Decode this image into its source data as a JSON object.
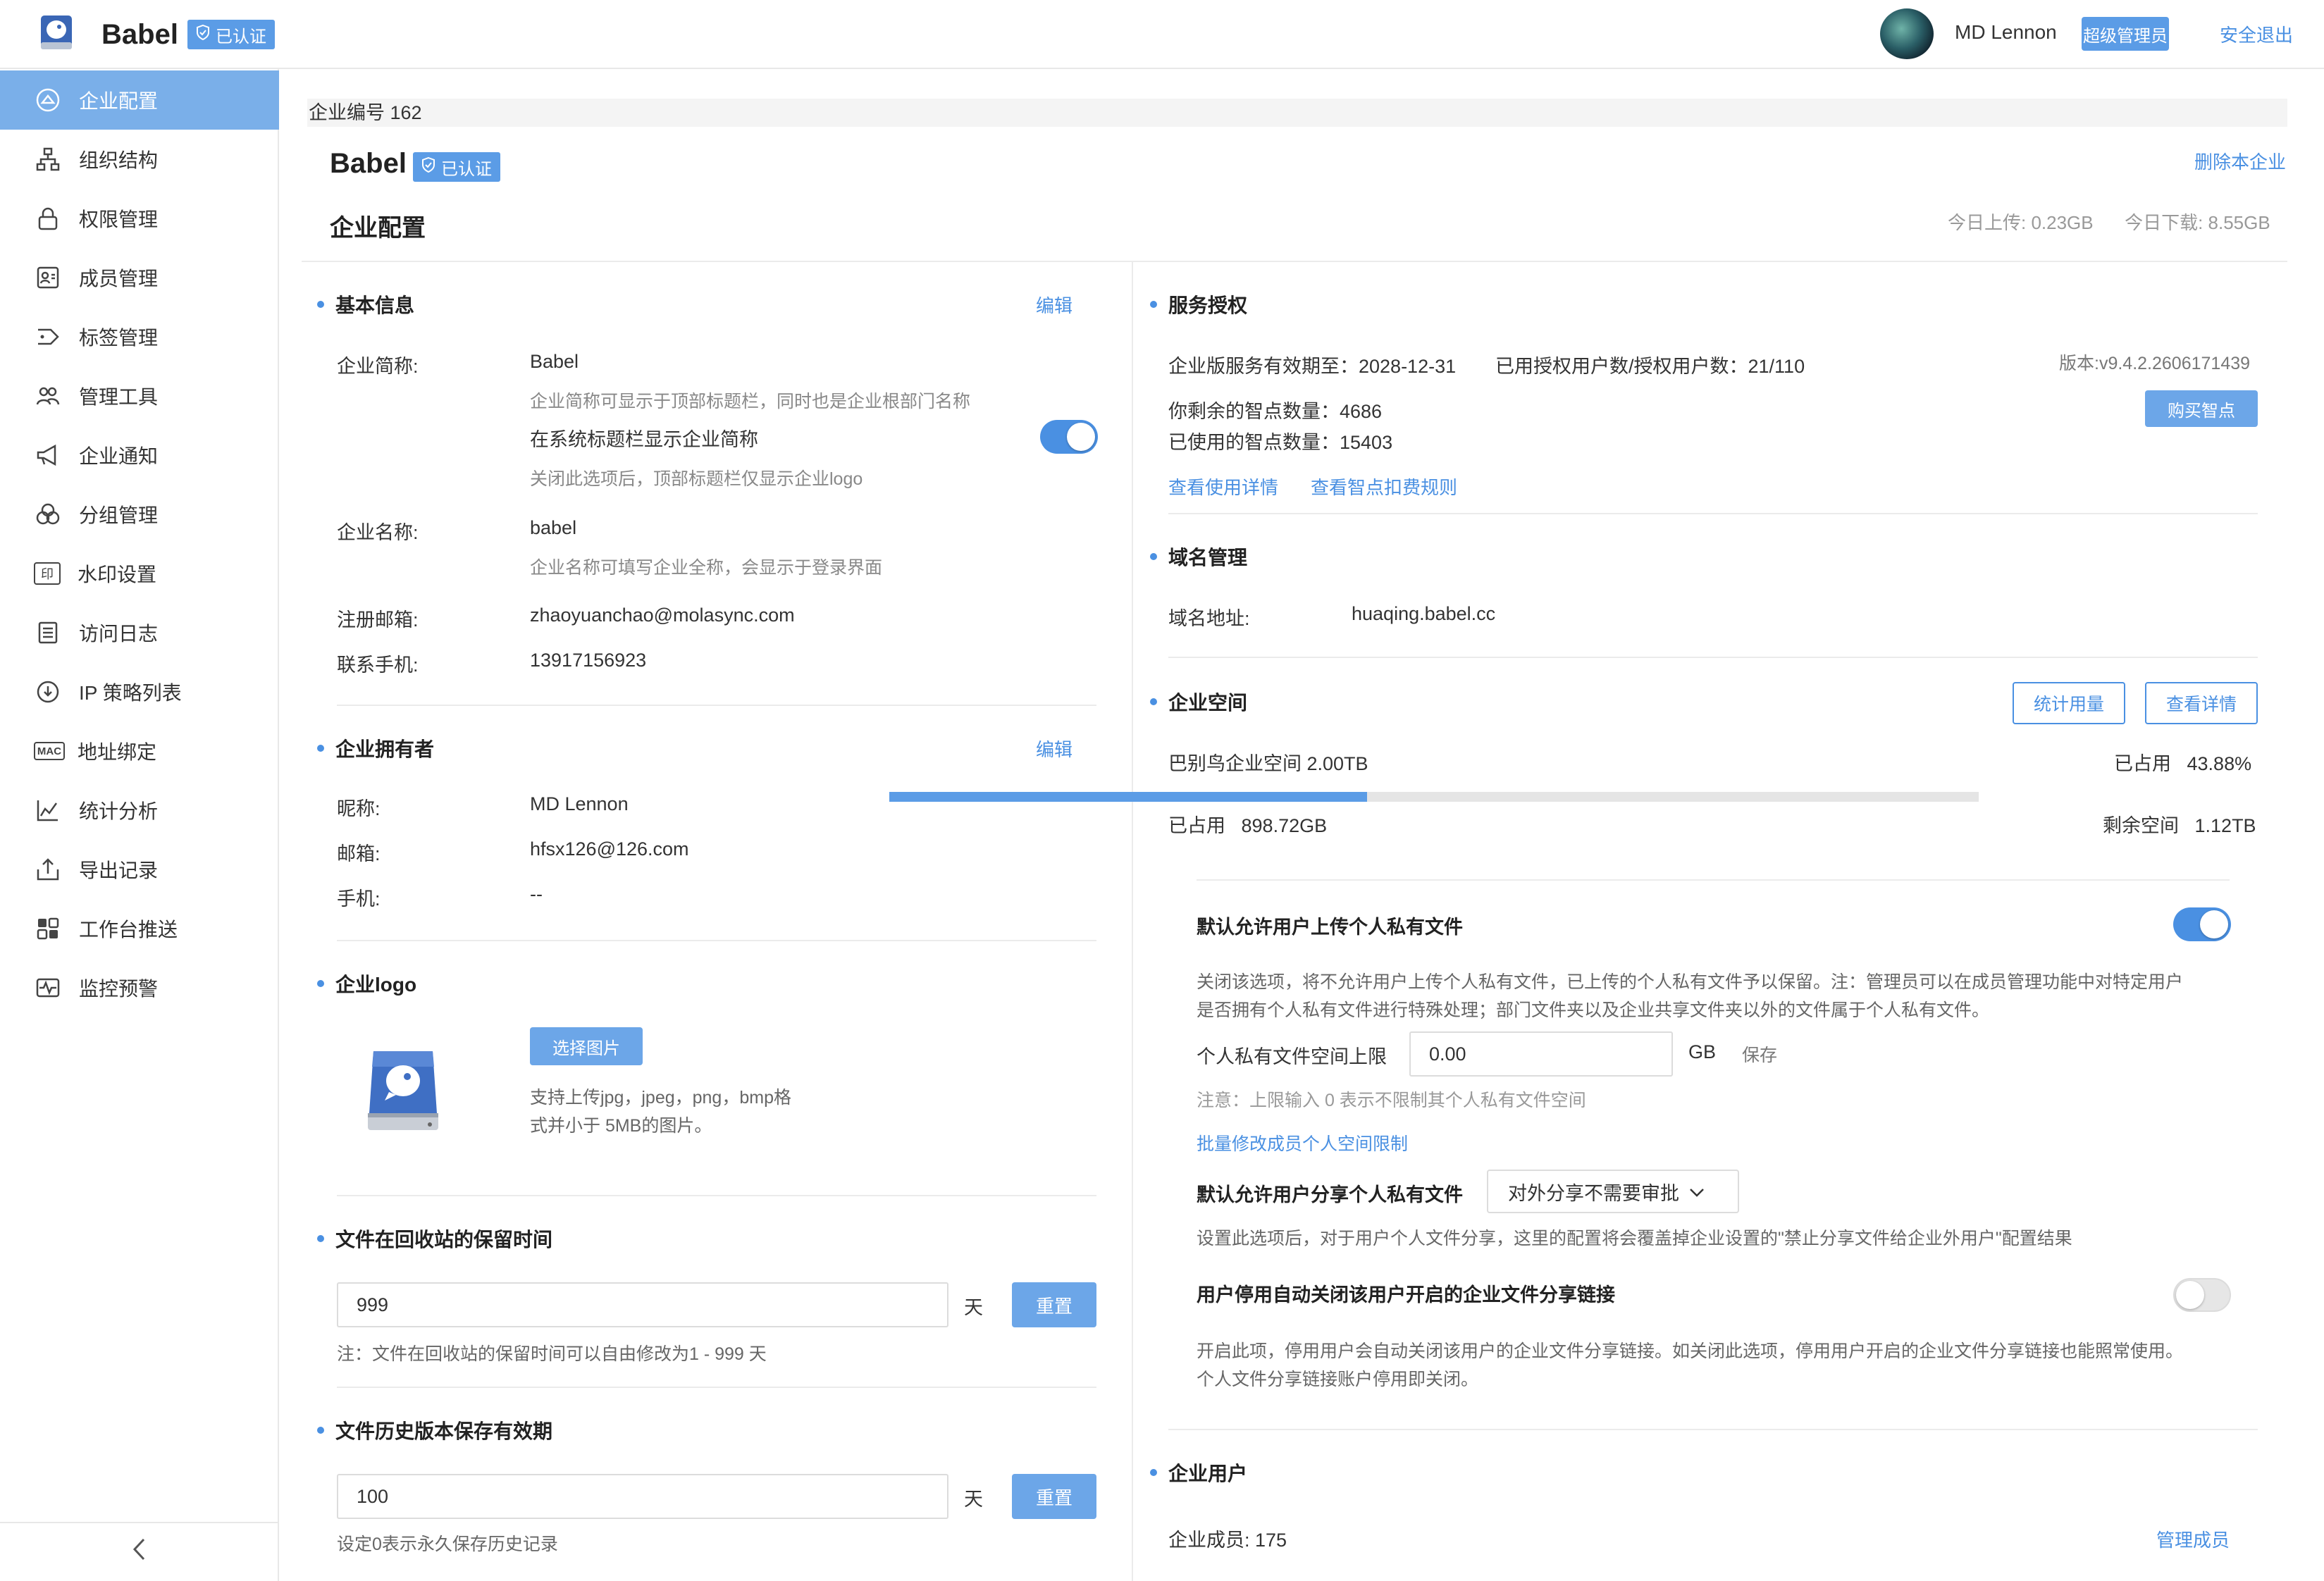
{
  "header": {
    "app_name": "Babel",
    "verified_label": "已认证",
    "user_name": "MD Lennon",
    "role": "超级管理员",
    "logout": "安全退出"
  },
  "sidebar": {
    "items": [
      {
        "label": "企业配置",
        "icon": "building-icon"
      },
      {
        "label": "组织结构",
        "icon": "org-chart-icon"
      },
      {
        "label": "权限管理",
        "icon": "lock-icon"
      },
      {
        "label": "成员管理",
        "icon": "id-card-icon"
      },
      {
        "label": "标签管理",
        "icon": "tag-icon"
      },
      {
        "label": "管理工具",
        "icon": "users-tool-icon"
      },
      {
        "label": "企业通知",
        "icon": "megaphone-icon"
      },
      {
        "label": "分组管理",
        "icon": "groups-icon"
      },
      {
        "label": "水印设置",
        "icon": "watermark-icon"
      },
      {
        "label": "访问日志",
        "icon": "log-icon"
      },
      {
        "label": "IP 策略列表",
        "icon": "ip-policy-icon"
      },
      {
        "label": "地址绑定",
        "icon": "mac-icon",
        "badge": "MAC"
      },
      {
        "label": "统计分析",
        "icon": "chart-icon"
      },
      {
        "label": "导出记录",
        "icon": "export-icon"
      },
      {
        "label": "工作台推送",
        "icon": "grid-icon"
      },
      {
        "label": "监控预警",
        "icon": "monitor-icon"
      }
    ],
    "watermark_glyph": "印"
  },
  "main": {
    "enterprise_id": "企业编号 162",
    "enterprise_name": "Babel",
    "delete_enterprise": "删除本企业",
    "page_title": "企业配置",
    "today_upload": "今日上传: 0.23GB",
    "today_download": "今日下载: 8.55GB"
  },
  "basic_info": {
    "title": "基本信息",
    "edit": "编辑",
    "short_name_label": "企业简称:",
    "short_name": "Babel",
    "short_name_hint": "企业简称可显示于顶部标题栏，同时也是企业根部门名称",
    "show_in_title_label": "在系统标题栏显示企业简称",
    "show_in_title_on": true,
    "show_in_title_hint": "关闭此选项后，顶部标题栏仅显示企业logo",
    "full_name_label": "企业名称:",
    "full_name": "babel",
    "full_name_hint": "企业名称可填写企业全称，会显示于登录界面",
    "email_label": "注册邮箱:",
    "email": "zhaoyuanchao@molasync.com",
    "phone_label": "联系手机:",
    "phone": "13917156923"
  },
  "owner": {
    "title": "企业拥有者",
    "edit": "编辑",
    "nickname_label": "昵称:",
    "nickname": "MD Lennon",
    "email_label": "邮箱:",
    "email": "hfsx126@126.com",
    "phone_label": "手机:",
    "phone": "--"
  },
  "logo": {
    "title": "企业logo",
    "choose_button": "选择图片",
    "hint_line1": "支持上传jpg，jpeg，png，bmp格",
    "hint_line2": "式并小于 5MB的图片。"
  },
  "recycle": {
    "title": "文件在回收站的保留时间",
    "value": "999",
    "unit": "天",
    "reset": "重置",
    "note": "注：文件在回收站的保留时间可以自由修改为1 - 999 天"
  },
  "history": {
    "title": "文件历史版本保存有效期",
    "value": "100",
    "unit": "天",
    "reset": "重置",
    "note": "设定0表示永久保存历史记录"
  },
  "service": {
    "title": "服务授权",
    "expiry_label": "企业版服务有效期至：",
    "expiry": "2028-12-31",
    "users_label": "已用授权用户数/授权用户数：",
    "users": "21/110",
    "version": "版本:v9.4.2.2606171439",
    "remaining_label": "你剩余的智点数量：",
    "remaining": "4686",
    "used_label": "已使用的智点数量：",
    "used": "15403",
    "buy_button": "购买智点",
    "usage_details": "查看使用详情",
    "deduction_rules": "查看智点扣费规则"
  },
  "domain": {
    "title": "域名管理",
    "address_label": "域名地址:",
    "address": "huaqing.babel.cc"
  },
  "space": {
    "title": "企业空间",
    "stat_button": "统计用量",
    "details_button": "查看详情",
    "total_label": "巴别鸟企业空间 2.00TB",
    "occupied_label": "已占用",
    "occupied_percent": "43.88%",
    "occupied_fraction": 0.4388,
    "used_label": "已占用",
    "used": "898.72GB",
    "remaining_label": "剩余空间",
    "remaining": "1.12TB"
  },
  "private_files": {
    "allow_upload_label": "默认允许用户上传个人私有文件",
    "allow_upload_on": true,
    "allow_upload_hint1": "关闭该选项，将不允许用户上传个人私有文件，已上传的个人私有文件予以保留。注：管理员可以在成员管理功能中对特定用户",
    "allow_upload_hint2": "是否拥有个人私有文件进行特殊处理；部门文件夹以及企业共享文件夹以外的文件属于个人私有文件。",
    "quota_label": "个人私有文件空间上限",
    "quota_value": "0.00",
    "quota_unit": "GB",
    "save": "保存",
    "quota_note": "注意：上限输入 0 表示不限制其个人私有文件空间",
    "batch_link": "批量修改成员个人空间限制",
    "share_label": "默认允许用户分享个人私有文件",
    "share_option": "对外分享不需要审批",
    "share_hint": "设置此选项后，对于用户个人文件分享，这里的配置将会覆盖掉企业设置的\"禁止分享文件给企业外用户\"配置结果",
    "auto_close_label": "用户停用自动关闭该用户开启的企业文件分享链接",
    "auto_close_on": false,
    "auto_close_hint1": "开启此项，停用用户会自动关闭该用户的企业文件分享链接。如关闭此选项，停用用户开启的企业文件分享链接也能照常使用。",
    "auto_close_hint2": "个人文件分享链接账户停用即关闭。"
  },
  "enterprise_users": {
    "title": "企业用户",
    "members": "企业成员: 175",
    "manage": "管理成员"
  },
  "colors": {
    "accent": "#4a90e2",
    "sidebar_active": "#7aafe9",
    "button": "#6ca6e8"
  }
}
